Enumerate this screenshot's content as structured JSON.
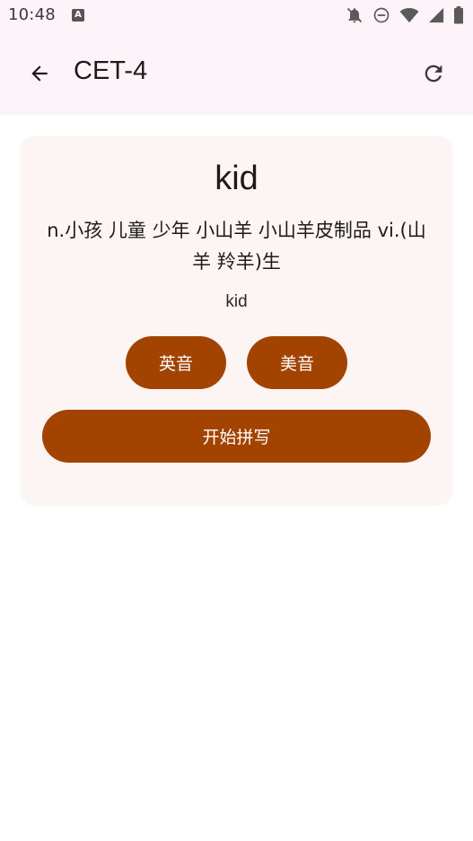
{
  "status_bar": {
    "time": "10:48",
    "keyboard_badge": "A"
  },
  "app_bar": {
    "title": "CET-4",
    "back_icon": "arrow-left-icon",
    "refresh_icon": "refresh-icon"
  },
  "card": {
    "word": "kid",
    "definition": "n.小孩 儿童 少年 小山羊 小山羊皮制品 vi.(山羊 羚羊)生",
    "phonetic": "kid",
    "uk_button_label": "英音",
    "us_button_label": "美音",
    "spell_button_label": "开始拼写"
  },
  "colors": {
    "accent": "#a24300",
    "card_background": "#fdf5f3",
    "app_bar_background": "#fdf4fa"
  }
}
